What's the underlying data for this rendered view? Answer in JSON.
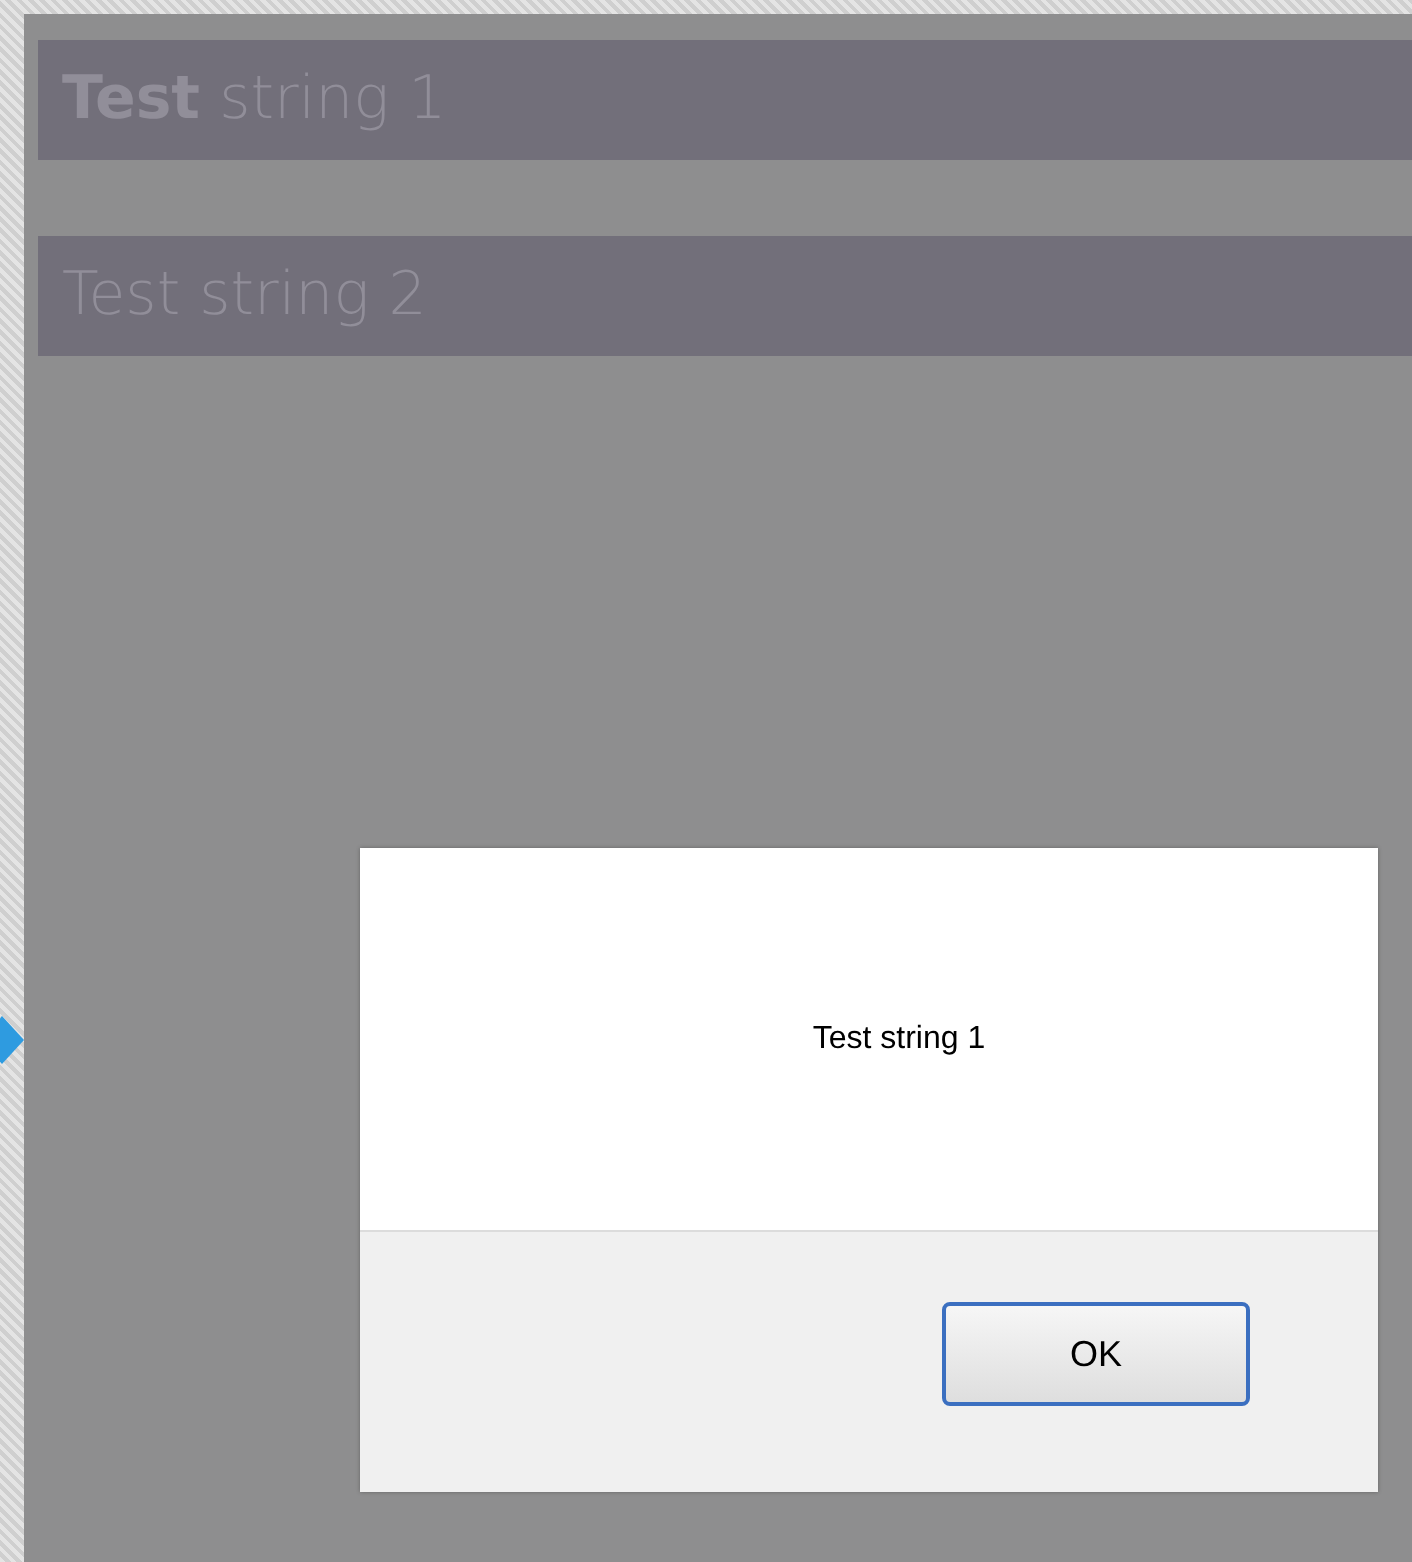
{
  "items": [
    {
      "label": "**Test** string 1"
    },
    {
      "label": "Test string 2"
    }
  ],
  "dialog": {
    "message": "Test string 1",
    "buttons": [
      "OK"
    ]
  }
}
